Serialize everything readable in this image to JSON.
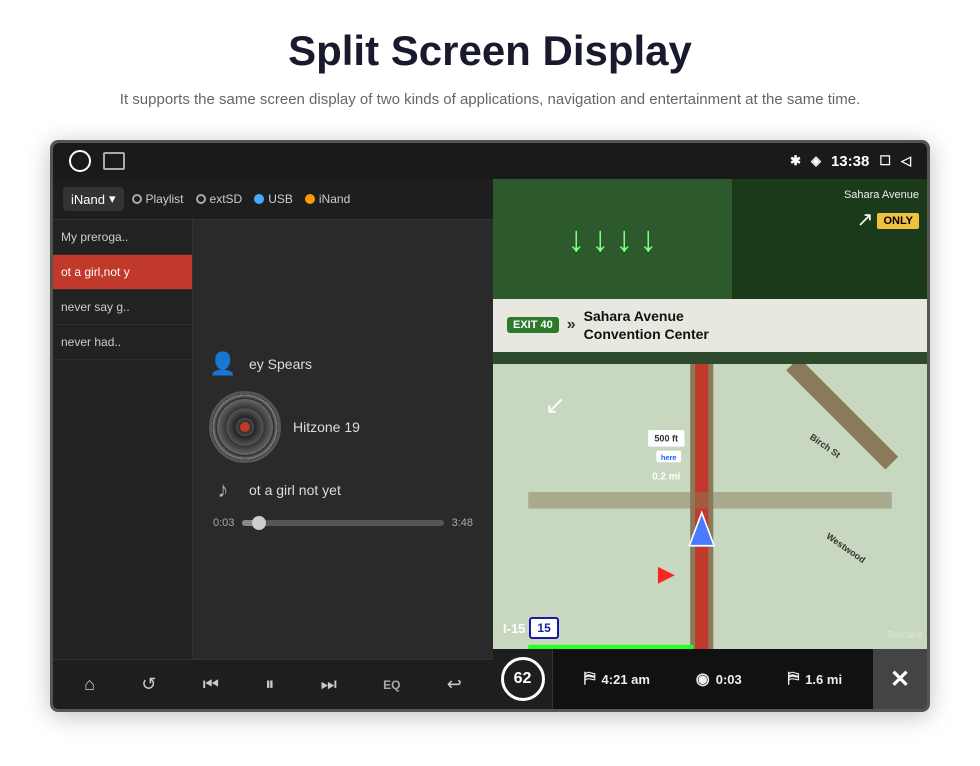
{
  "page": {
    "title": "Split Screen Display",
    "subtitle": "It supports the same screen display of two kinds of applications,\nnavigation and entertainment at the same time."
  },
  "status_bar": {
    "time": "13:38",
    "bluetooth_icon": "✱",
    "location_icon": "◈",
    "window_icon": "☐",
    "back_icon": "◁"
  },
  "music_player": {
    "source_label": "iNand",
    "source_chevron": "▾",
    "tabs": [
      {
        "label": "Playlist",
        "dot": "plain"
      },
      {
        "label": "extSD",
        "dot": "blue"
      },
      {
        "label": "USB",
        "dot": "plain"
      },
      {
        "label": "iNand",
        "dot": "orange"
      }
    ],
    "playlist": [
      {
        "text": "My preroga..",
        "active": false
      },
      {
        "text": "ot a girl,not y",
        "active": true
      },
      {
        "text": "never say g..",
        "active": false
      },
      {
        "text": "never had..",
        "active": false
      }
    ],
    "artist": "ey Spears",
    "album": "Hitzone 19",
    "song": "ot a girl not yet",
    "time_current": "0:03",
    "time_total": "3:48",
    "progress_percent": 8,
    "controls": {
      "home": "⌂",
      "repeat": "↺",
      "prev": "⏮",
      "play_pause": "⏸",
      "next": "⏭",
      "eq": "EQ",
      "back": "↩"
    }
  },
  "navigation": {
    "street_top": "Sahara Avenue",
    "only_label": "ONLY",
    "exit_number": "EXIT 40",
    "exit_arrow": "»",
    "exit_street_line1": "Sahara Avenue",
    "exit_street_line2": "Convention Center",
    "speed_limit": "62",
    "stats": [
      {
        "flag": "⛿",
        "value": "4:21 am"
      },
      {
        "flag": "◎",
        "value": "0:03"
      },
      {
        "flag": "⛿",
        "value": "1.6 mi"
      }
    ],
    "close_icon": "✕",
    "interstate": "I-15",
    "interstate_number": "15",
    "distance_label": "0.2 mi",
    "dist_500": "500 ft",
    "street_birch": "Birch St",
    "street_west": "Westwood"
  }
}
